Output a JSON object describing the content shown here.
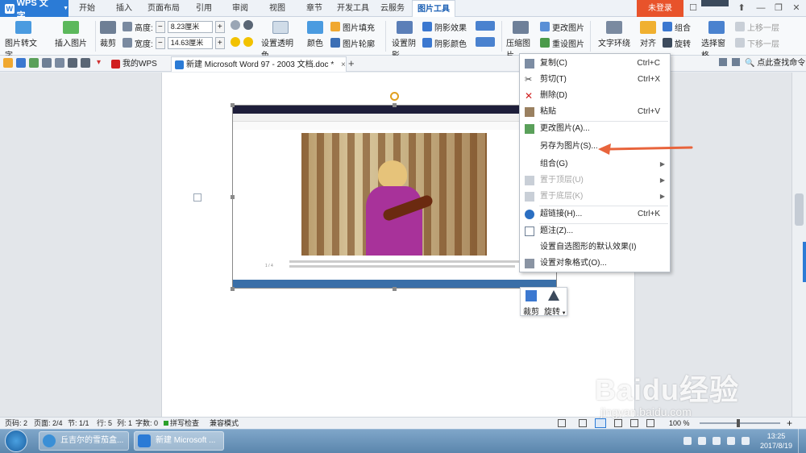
{
  "app": {
    "name": "WPS 文字",
    "login": "未登录"
  },
  "ribbon_tabs": [
    "开始",
    "插入",
    "页面布局",
    "引用",
    "审阅",
    "视图",
    "章节",
    "开发工具",
    "云服务",
    "图片工具"
  ],
  "ribbon": {
    "pic_to_text": "图片转文字",
    "insert_pic": "插入图片",
    "crop": "裁剪",
    "height_label": "高度:",
    "height_value": "8.23厘米",
    "width_label": "宽度:",
    "width_value": "14.63厘米",
    "transparent": "设置透明色",
    "color": "颜色",
    "pic_fill": "图片填充",
    "pic_outline": "图片轮廓",
    "set_shadow": "设置阴影",
    "shadow_effect": "阴影效果",
    "shadow_color": "阴影颜色",
    "compress": "压缩图片",
    "change_pic": "更改图片",
    "reset_pic": "重设图片",
    "text_wrap": "文字环绕",
    "align": "对齐",
    "combine": "组合",
    "rotate": "旋转",
    "select_pane": "选择窗格",
    "up_layer": "上移一层",
    "down_layer": "下移一层"
  },
  "doc_tabs": [
    {
      "label": "我的WPS"
    },
    {
      "label": "新建 Microsoft Word 97 - 2003 文档.doc *"
    }
  ],
  "search_label": "点此查找命令",
  "context_menu": [
    {
      "label": "复制(C)",
      "shortcut": "Ctrl+C",
      "icon": "copy-icon",
      "disabled": false
    },
    {
      "label": "剪切(T)",
      "shortcut": "Ctrl+X",
      "icon": "cut-icon",
      "disabled": false
    },
    {
      "label": "删除(D)",
      "shortcut": "",
      "icon": "delete-icon",
      "disabled": false
    },
    {
      "label": "粘贴",
      "shortcut": "Ctrl+V",
      "icon": "paste-icon",
      "disabled": false
    },
    {
      "label": "更改图片(A)...",
      "shortcut": "",
      "icon": "change-picture-icon",
      "disabled": false
    },
    {
      "label": "另存为图片(S)...",
      "shortcut": "",
      "icon": "",
      "disabled": false
    },
    {
      "label": "组合(G)",
      "shortcut": "",
      "icon": "",
      "disabled": false,
      "submenu": true
    },
    {
      "label": "置于顶层(U)",
      "shortcut": "",
      "icon": "bring-front-icon",
      "disabled": true,
      "submenu": true
    },
    {
      "label": "置于底层(K)",
      "shortcut": "",
      "icon": "send-back-icon",
      "disabled": true,
      "submenu": true
    },
    {
      "label": "超链接(H)...",
      "shortcut": "Ctrl+K",
      "icon": "hyperlink-icon",
      "disabled": false
    },
    {
      "label": "题注(Z)...",
      "shortcut": "",
      "icon": "caption-icon",
      "disabled": false
    },
    {
      "label": "设置自选图形的默认效果(I)",
      "shortcut": "",
      "icon": "",
      "disabled": false
    },
    {
      "label": "设置对象格式(O)...",
      "shortcut": "",
      "icon": "format-object-icon",
      "disabled": false
    }
  ],
  "float_toolbar": {
    "crop": "裁剪",
    "rotate": "旋转"
  },
  "statusbar": {
    "page": "页码: 2",
    "pages": "页面: 2/4",
    "section": "节: 1/1",
    "row": "行: 5",
    "col": "列: 1",
    "words": "字数: 0",
    "spell": "拼写检查",
    "compat": "兼容模式",
    "zoom": "100 %"
  },
  "taskbar": {
    "items": [
      "丘吉尔的雪茄盒...",
      "新建 Microsoft ..."
    ],
    "time": "13:25",
    "date": "2017/8/19"
  },
  "image_page_number": "1 / 4",
  "watermark": {
    "brand": "Baidu经验",
    "url": "jingyan.baidu.com"
  },
  "colors": {
    "accent": "#2b7bd6",
    "login": "#e8532b",
    "arrow": "#e8643c"
  }
}
